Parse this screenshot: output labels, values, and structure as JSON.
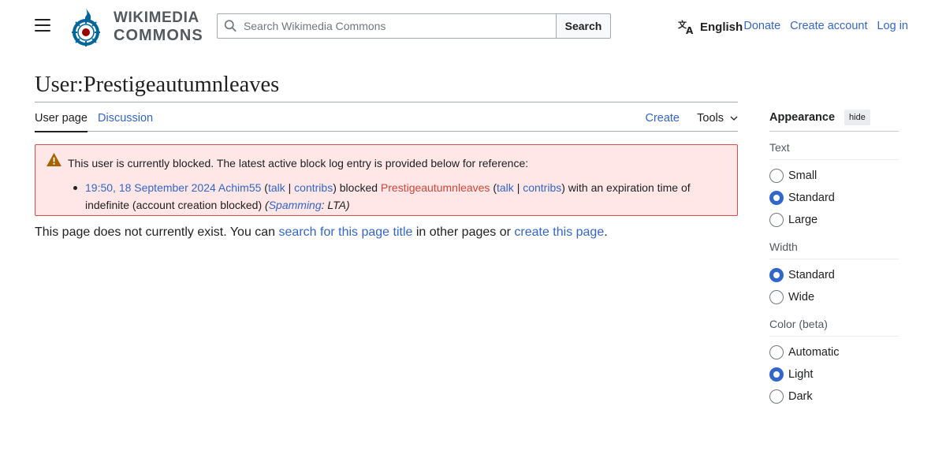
{
  "header": {
    "logo_line1": "WIKIMEDIA",
    "logo_line2": "COMMONS",
    "search_placeholder": "Search Wikimedia Commons",
    "search_button": "Search",
    "language": "English",
    "donate": "Donate",
    "create_account": "Create account",
    "log_in": "Log in"
  },
  "page": {
    "title": "User:Prestigeautumnleaves",
    "tabs": {
      "user_page": "User page",
      "discussion": "Discussion",
      "create": "Create",
      "tools": "Tools"
    }
  },
  "block_notice": {
    "message": "This user is currently blocked. The latest active block log entry is provided below for reference:",
    "entry": {
      "timestamp": "19:50, 18 September 2024",
      "admin": "Achim55",
      "talk1": "talk",
      "sep": "|",
      "contribs1": "contribs",
      "action": ") blocked ",
      "target": "Prestigeautumnleaves",
      "talk2": "talk",
      "contribs2": "contribs",
      "expiry": ") with an expiration time of indefinite (account creation blocked) ",
      "reason_prefix": "(",
      "reason_link": "Spamming",
      "reason_rest": ": LTA)"
    }
  },
  "not_exist": {
    "text1": "This page does not currently exist. You can ",
    "link1": "search for this page title",
    "text2": " in other pages or ",
    "link2": "create this page",
    "text3": "."
  },
  "appearance": {
    "title": "Appearance",
    "hide": "hide",
    "text_label": "Text",
    "text_options": [
      "Small",
      "Standard",
      "Large"
    ],
    "text_selected": "Standard",
    "width_label": "Width",
    "width_options": [
      "Standard",
      "Wide"
    ],
    "width_selected": "Standard",
    "color_label": "Color (beta)",
    "color_options": [
      "Automatic",
      "Light",
      "Dark"
    ],
    "color_selected": "Light"
  },
  "colors": {
    "link": "#3366cc",
    "redlink": "#d3443a",
    "notice_bg": "#fee7e6",
    "notice_border": "#d4504c"
  }
}
